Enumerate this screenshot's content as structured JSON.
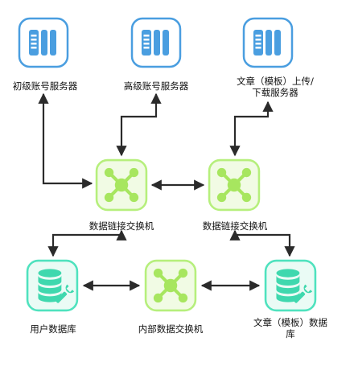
{
  "nodes": {
    "basic_account_server": {
      "label": "初级账号服务器",
      "kind": "server"
    },
    "advanced_account_server": {
      "label": "高级账号服务器",
      "kind": "server"
    },
    "article_upload_server": {
      "label_line1": "文章（模板）上传/",
      "label_line2": "下载服务器",
      "kind": "server"
    },
    "data_link_switch_1": {
      "label": "数据链接交换机",
      "kind": "switch"
    },
    "data_link_switch_2": {
      "label": "数据链接交换机",
      "kind": "switch"
    },
    "internal_data_switch": {
      "label": "内部数据交换机",
      "kind": "switch"
    },
    "user_database": {
      "label": "用户数据库",
      "kind": "database"
    },
    "article_database": {
      "label_line1": "文章（模板）数据",
      "label_line2": "库",
      "kind": "database"
    }
  },
  "colors": {
    "server_border": "#4a9ee0",
    "server_fill": "#4a9ee0",
    "switch_border": "#b6ef7c",
    "switch_bg": "#f1fbe4",
    "switch_fill": "#a7e65f",
    "db_border": "#4fe2be",
    "db_bg": "#eafbf5",
    "db_fill": "#3fd8ae",
    "line": "#2b2b2b"
  }
}
